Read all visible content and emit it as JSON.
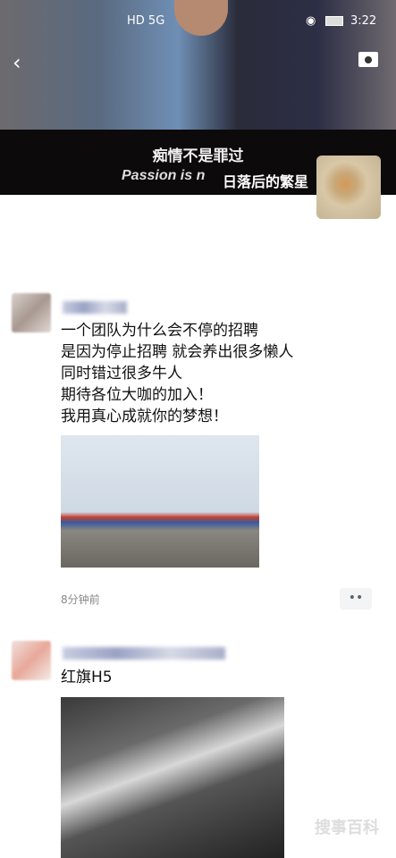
{
  "status_bar": {
    "network": "HD 5G",
    "time": "3:22"
  },
  "header": {
    "back_icon": "chevron-left-icon",
    "camera_icon": "camera-icon"
  },
  "cover": {
    "subtitle_cn": "痴情不是罪过",
    "subtitle_en": "Passion is n",
    "nickname": "日落后的繁星"
  },
  "posts": [
    {
      "text": [
        "一个团队为什么会不停的招聘",
        "是因为停止招聘 就会养出很多懒人",
        "同时错过很多牛人",
        "期待各位大咖的加入！",
        "我用真心成就你的梦想！"
      ],
      "time": "8分钟前",
      "more_label": "••"
    },
    {
      "text": [
        "红旗H5"
      ]
    }
  ],
  "watermark": "搜事百科"
}
